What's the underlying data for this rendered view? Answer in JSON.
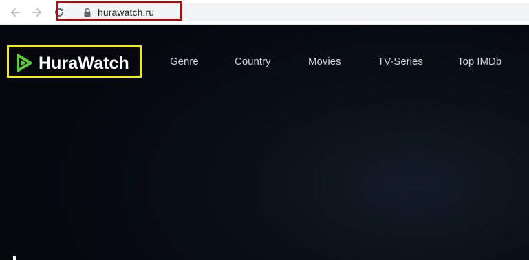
{
  "browser": {
    "url": "hurawatch.ru",
    "icons": {
      "back": "arrow-left-icon",
      "forward": "arrow-right-icon",
      "reload": "reload-icon",
      "lock": "lock-icon"
    },
    "highlight_color": "#a40e0e"
  },
  "site": {
    "logo": {
      "text": "HuraWatch",
      "icon": "play-icon",
      "icon_color": "#5ecb3a",
      "highlight_color": "#f2ec13"
    },
    "nav": [
      {
        "label": "Genre"
      },
      {
        "label": "Country"
      },
      {
        "label": "Movies"
      },
      {
        "label": "TV-Series"
      },
      {
        "label": "Top IMDb"
      }
    ],
    "background_color": "#05080d"
  }
}
